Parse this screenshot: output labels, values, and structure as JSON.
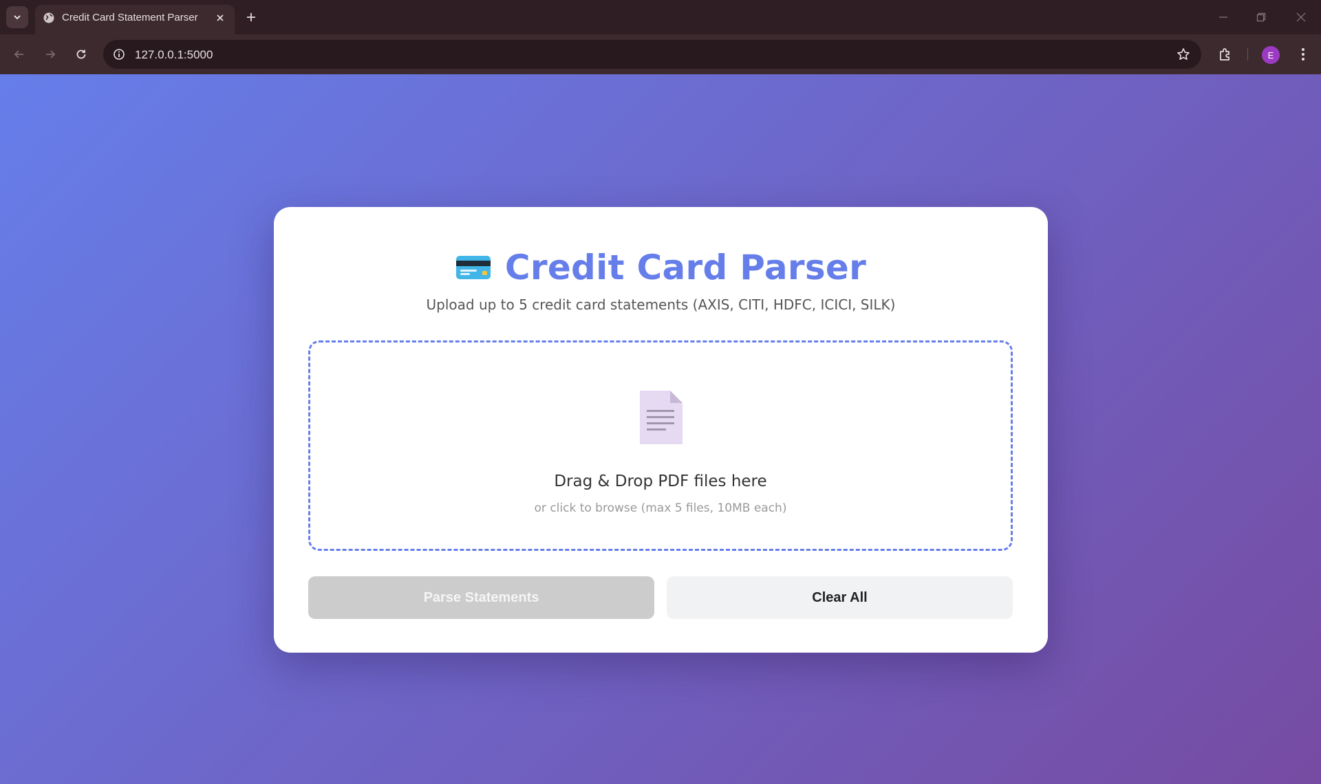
{
  "browser": {
    "tab_title": "Credit Card Statement Parser",
    "url": "127.0.0.1:5000",
    "profile_initial": "E"
  },
  "page": {
    "title": "Credit Card Parser",
    "subtitle": "Upload up to 5 credit card statements (AXIS, CITI, HDFC, ICICI, SILK)",
    "dropzone": {
      "title": "Drag & Drop PDF files here",
      "hint": "or click to browse (max 5 files, 10MB each)"
    },
    "buttons": {
      "parse_label": "Parse Statements",
      "clear_label": "Clear All"
    }
  },
  "icons": {
    "title_icon": "credit-card-icon",
    "drop_icon": "document-icon"
  },
  "colors": {
    "accent": "#667eea",
    "gradient_end": "#764ba2",
    "disabled_button": "#cccccc"
  }
}
